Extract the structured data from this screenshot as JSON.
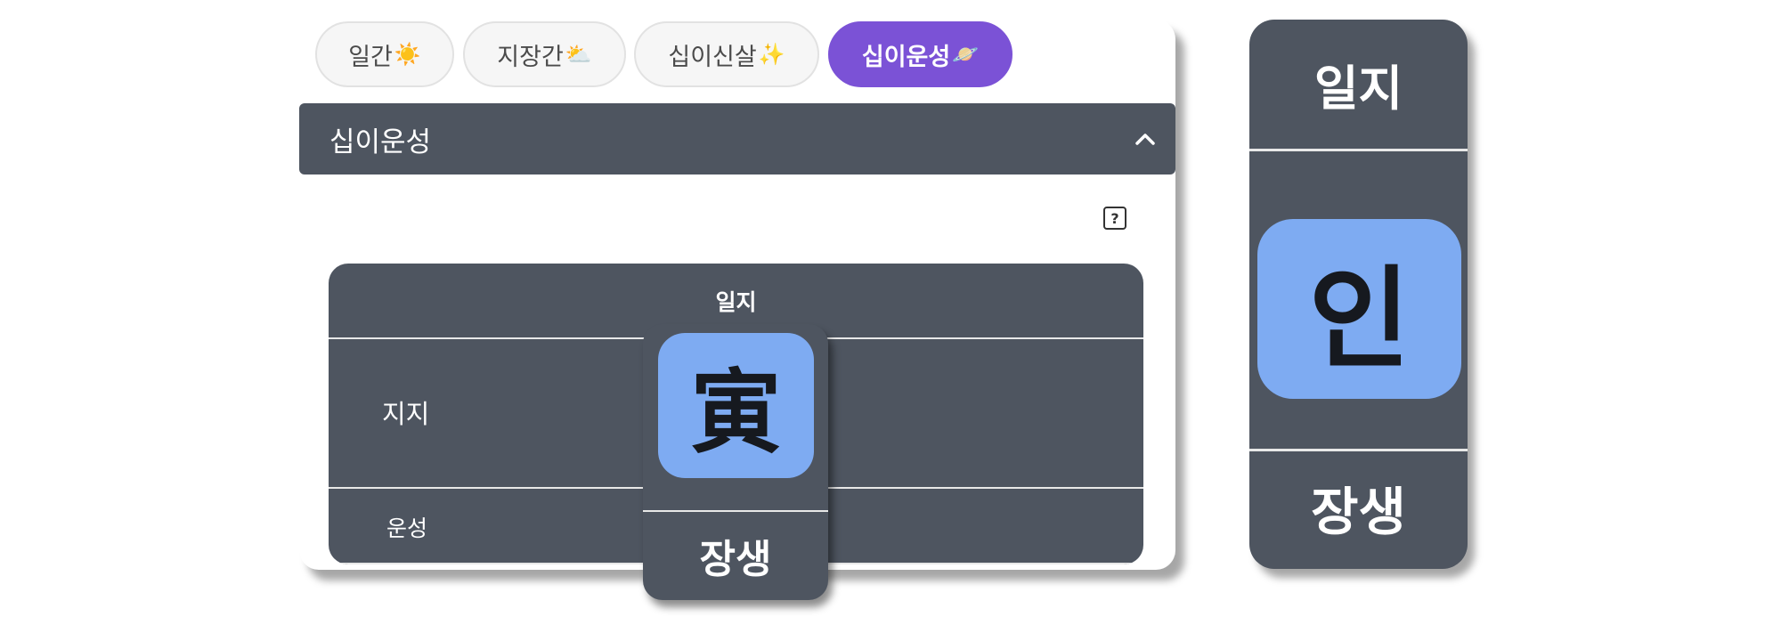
{
  "tabs": [
    {
      "label": "일간",
      "emoji": "☀️",
      "active": false
    },
    {
      "label": "지장간",
      "emoji": "⛅",
      "active": false
    },
    {
      "label": "십이신살",
      "emoji": "✨",
      "active": false
    },
    {
      "label": "십이운성",
      "emoji": "🪐",
      "active": true
    }
  ],
  "accordion": {
    "title": "십이운성",
    "icon": "chevron-up-icon"
  },
  "help": {
    "icon": "question-square-icon",
    "symbol": "?"
  },
  "table": {
    "column_header": "일지",
    "rows": [
      {
        "label": "지지",
        "value": "寅"
      },
      {
        "label": "운성",
        "value": "장생"
      }
    ]
  },
  "zoom": {
    "header": "일지",
    "hangul": "인",
    "stage": "장생"
  },
  "colors": {
    "accent": "#7b52d6",
    "panel": "#4e5560",
    "tile": "#7eabf2"
  }
}
